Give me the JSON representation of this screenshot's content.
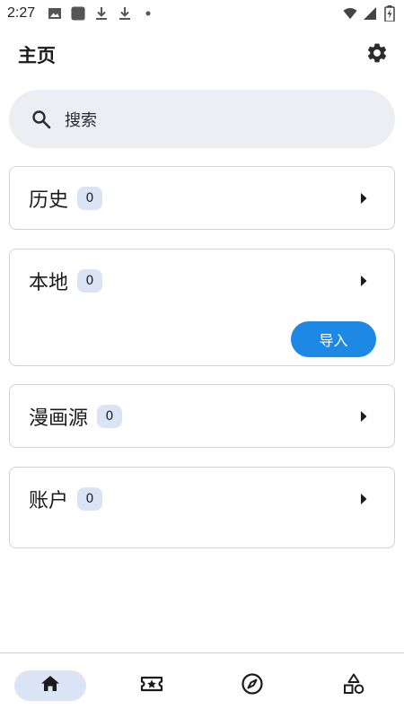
{
  "status_bar": {
    "time": "2:27",
    "left_icons": [
      "image-icon",
      "app-square-icon",
      "download-icon",
      "download-icon",
      "dot-icon"
    ],
    "right_icons": [
      "wifi-icon",
      "signal-icon",
      "battery-charging-icon"
    ]
  },
  "app_bar": {
    "title": "主页",
    "settings_icon": "gear-icon"
  },
  "search": {
    "placeholder": "搜索",
    "icon": "search-icon"
  },
  "cards": [
    {
      "title": "历史",
      "count": "0"
    },
    {
      "title": "本地",
      "count": "0",
      "action_label": "导入"
    },
    {
      "title": "漫画源",
      "count": "0"
    },
    {
      "title": "账户",
      "count": "0"
    }
  ],
  "bottom_nav": {
    "items": [
      {
        "icon": "home-icon",
        "active": true
      },
      {
        "icon": "ticket-star-icon",
        "active": false
      },
      {
        "icon": "compass-icon",
        "active": false
      },
      {
        "icon": "shapes-icon",
        "active": false
      }
    ]
  },
  "colors": {
    "accent": "#1e88e5",
    "badge_bg": "#dae4f5",
    "search_bg": "#eceef4",
    "card_border": "#cfd2d8"
  }
}
